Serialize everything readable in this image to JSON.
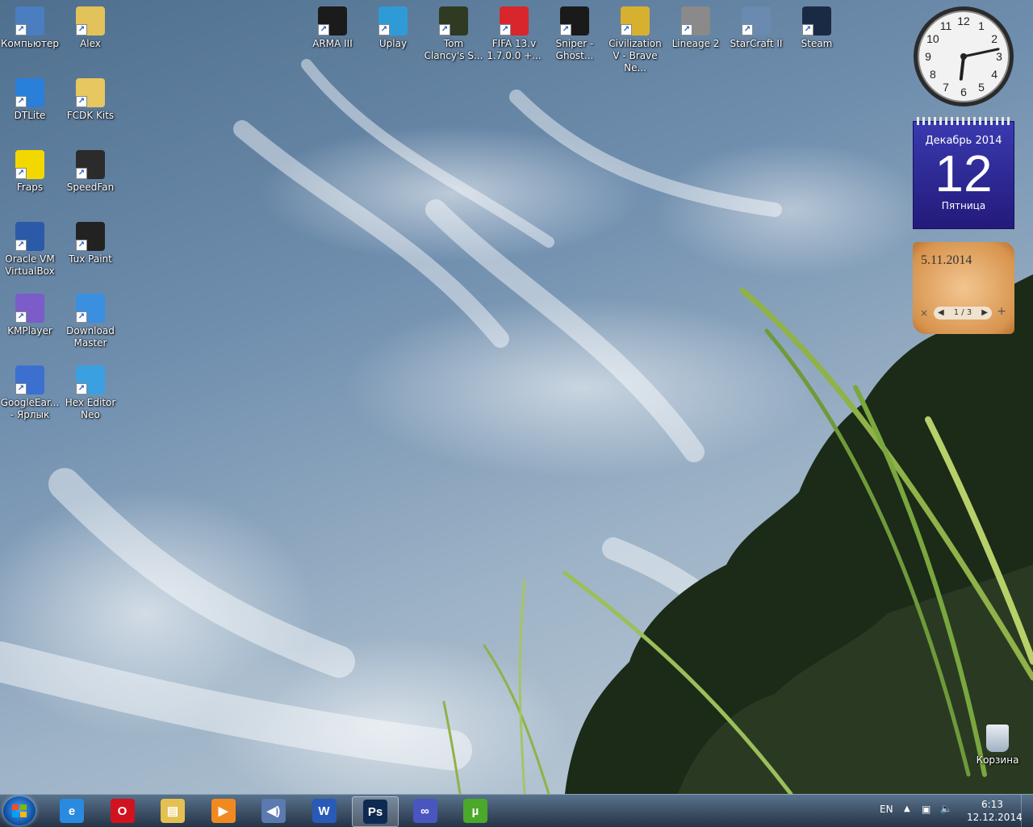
{
  "desktop": {
    "icons_left": [
      {
        "label": "Компьютер",
        "icon": "computer-icon",
        "color": "#4a7ec0"
      },
      {
        "label": "Alex",
        "icon": "user-folder-icon",
        "color": "#e2c25a"
      },
      {
        "label": "DTLite",
        "icon": "daemon-tools-icon",
        "color": "#2a7fd8"
      },
      {
        "label": "FCDK Kits",
        "icon": "folder-icon",
        "color": "#e7c760"
      },
      {
        "label": "Fraps",
        "icon": "fraps-icon",
        "color": "#f2d800"
      },
      {
        "label": "SpeedFan",
        "icon": "speedfan-icon",
        "color": "#2b2b2b"
      },
      {
        "label": "Oracle VM VirtualBox",
        "icon": "virtualbox-icon",
        "color": "#2a5aa8"
      },
      {
        "label": "Tux Paint",
        "icon": "tux-paint-icon",
        "color": "#222222"
      },
      {
        "label": "KMPlayer",
        "icon": "kmplayer-icon",
        "color": "#7b5cc8"
      },
      {
        "label": "Download Master",
        "icon": "download-master-icon",
        "color": "#3a8fe0"
      },
      {
        "label": "GoogleEar... - Ярлык",
        "icon": "google-earth-icon",
        "color": "#3b6fd0"
      },
      {
        "label": "Hex Editor Neo",
        "icon": "hex-editor-icon",
        "color": "#3aa0e0"
      }
    ],
    "icons_top": [
      {
        "label": "ARMA III",
        "icon": "arma-icon",
        "color": "#1b1b1b"
      },
      {
        "label": "Uplay",
        "icon": "uplay-icon",
        "color": "#2e9bd6"
      },
      {
        "label": "Tom Clancy's S...",
        "icon": "splinter-cell-icon",
        "color": "#2f3a22"
      },
      {
        "label": "FIFA 13.v 1.7.0.0 +...",
        "icon": "fifa-icon",
        "color": "#d8262c"
      },
      {
        "label": "Sniper - Ghost...",
        "icon": "sniper-icon",
        "color": "#1a1a1a"
      },
      {
        "label": "Civilization V - Brave Ne...",
        "icon": "civilization-icon",
        "color": "#d8b030"
      },
      {
        "label": "Lineage 2",
        "icon": "lineage-icon",
        "color": "#8a8a8a"
      },
      {
        "label": "StarCraft II",
        "icon": "starcraft-icon",
        "color": "#6a8ab0"
      },
      {
        "label": "Steam",
        "icon": "steam-icon",
        "color": "#1b2a44"
      }
    ],
    "recycle_bin": {
      "label": "Корзина",
      "icon": "recycle-bin-icon"
    }
  },
  "gadgets": {
    "clock": {
      "hour": 6,
      "minute": 13,
      "numerals": [
        "12",
        "1",
        "2",
        "3",
        "4",
        "5",
        "6",
        "7",
        "8",
        "9",
        "10",
        "11"
      ]
    },
    "calendar": {
      "month_year": "Декабрь 2014",
      "day": "12",
      "weekday": "Пятница"
    },
    "notes": {
      "date": "5.11.2014",
      "pager": "1 / 3",
      "close": "×",
      "add": "+"
    }
  },
  "taskbar": {
    "pinned": [
      {
        "name": "ie",
        "icon": "internet-explorer-icon",
        "glyph": "e",
        "color": "#2a8ae0"
      },
      {
        "name": "opera",
        "icon": "opera-icon",
        "glyph": "O",
        "color": "#d2121e"
      },
      {
        "name": "explorer",
        "icon": "file-explorer-icon",
        "glyph": "▤",
        "color": "#e4c050"
      },
      {
        "name": "media",
        "icon": "media-player-icon",
        "glyph": "▶",
        "color": "#f08a20"
      },
      {
        "name": "volume-mixer",
        "icon": "audio-icon",
        "glyph": "◀)",
        "color": "#5a7ab0"
      },
      {
        "name": "word",
        "icon": "word-icon",
        "glyph": "W",
        "color": "#2a5ab8"
      },
      {
        "name": "photoshop",
        "icon": "photoshop-icon",
        "glyph": "Ps",
        "color": "#0f2a50"
      },
      {
        "name": "infinity",
        "icon": "infinity-icon",
        "glyph": "∞",
        "color": "#4a56c0"
      },
      {
        "name": "utorrent",
        "icon": "utorrent-icon",
        "glyph": "µ",
        "color": "#4aa82a"
      }
    ],
    "active_index": 6,
    "tray": {
      "language": "EN",
      "time": "6:13",
      "date": "12.12.2014"
    }
  }
}
